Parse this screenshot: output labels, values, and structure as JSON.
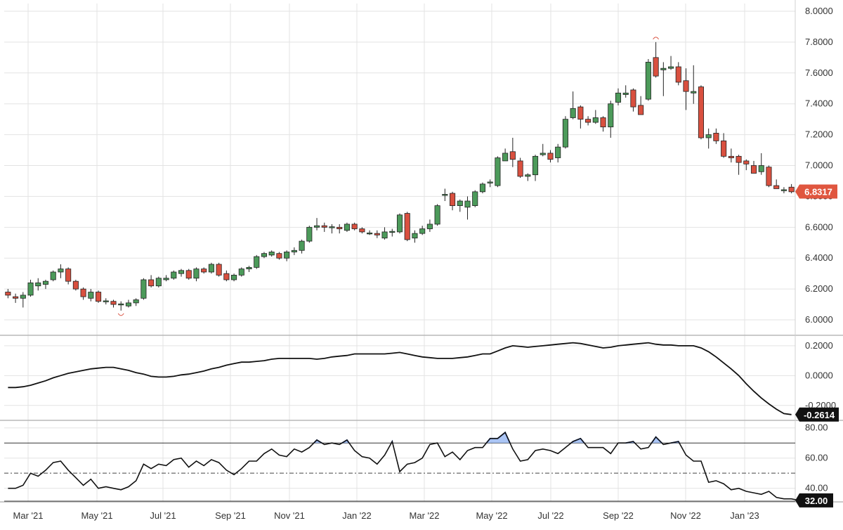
{
  "chart_data": {
    "type": "candlestick",
    "x_labels": [
      "Mar '21",
      "May '21",
      "Jul '21",
      "Sep '21",
      "Nov '21",
      "Jan '22",
      "Mar '22",
      "May '22",
      "Jul '22",
      "Sep '22",
      "Nov '22",
      "Jan '23"
    ],
    "price_axis": {
      "ylim": [
        5.9,
        8.05
      ],
      "ticks": [
        "8.0000",
        "7.8000",
        "7.6000",
        "7.4000",
        "7.2000",
        "7.0000",
        "6.8000",
        "6.6000",
        "6.4000",
        "6.2000",
        "6.0000"
      ],
      "tick_values": [
        8.0,
        7.8,
        7.6,
        7.4,
        7.2,
        7.0,
        6.8,
        6.6,
        6.4,
        6.2,
        6.0
      ]
    },
    "last_price": {
      "value": 6.8317,
      "label": "6.8317",
      "color": "#e0563f"
    },
    "colors": {
      "up": "#4c9a5a",
      "down": "#d9503f",
      "line": "#111111",
      "overbought_fill": "#8fb2f2",
      "overbought_line": "#2f63d8"
    },
    "candles": [
      [
        6.18,
        6.2,
        6.14,
        6.16
      ],
      [
        6.15,
        6.17,
        6.11,
        6.14
      ],
      [
        6.14,
        6.18,
        6.08,
        6.16
      ],
      [
        6.16,
        6.26,
        6.15,
        6.24
      ],
      [
        6.22,
        6.27,
        6.19,
        6.24
      ],
      [
        6.23,
        6.26,
        6.2,
        6.25
      ],
      [
        6.26,
        6.32,
        6.25,
        6.31
      ],
      [
        6.31,
        6.36,
        6.27,
        6.33
      ],
      [
        6.33,
        6.34,
        6.23,
        6.25
      ],
      [
        6.25,
        6.26,
        6.19,
        6.2
      ],
      [
        6.2,
        6.21,
        6.13,
        6.15
      ],
      [
        6.14,
        6.2,
        6.12,
        6.18
      ],
      [
        6.18,
        6.19,
        6.11,
        6.12
      ],
      [
        6.12,
        6.14,
        6.1,
        6.12
      ],
      [
        6.12,
        6.13,
        6.08,
        6.1
      ],
      [
        6.1,
        6.12,
        6.06,
        6.1
      ],
      [
        6.09,
        6.13,
        6.08,
        6.11
      ],
      [
        6.11,
        6.14,
        6.09,
        6.13
      ],
      [
        6.14,
        6.27,
        6.13,
        6.26
      ],
      [
        6.26,
        6.29,
        6.21,
        6.22
      ],
      [
        6.22,
        6.28,
        6.21,
        6.27
      ],
      [
        6.26,
        6.29,
        6.25,
        6.27
      ],
      [
        6.27,
        6.32,
        6.26,
        6.31
      ],
      [
        6.3,
        6.33,
        6.28,
        6.32
      ],
      [
        6.32,
        6.33,
        6.26,
        6.27
      ],
      [
        6.27,
        6.34,
        6.25,
        6.33
      ],
      [
        6.33,
        6.34,
        6.3,
        6.31
      ],
      [
        6.31,
        6.37,
        6.3,
        6.36
      ],
      [
        6.36,
        6.37,
        6.28,
        6.29
      ],
      [
        6.3,
        6.32,
        6.25,
        6.26
      ],
      [
        6.26,
        6.3,
        6.25,
        6.29
      ],
      [
        6.29,
        6.34,
        6.28,
        6.33
      ],
      [
        6.33,
        6.35,
        6.31,
        6.34
      ],
      [
        6.34,
        6.42,
        6.33,
        6.41
      ],
      [
        6.41,
        6.44,
        6.4,
        6.43
      ],
      [
        6.42,
        6.45,
        6.41,
        6.44
      ],
      [
        6.43,
        6.44,
        6.39,
        6.4
      ],
      [
        6.4,
        6.45,
        6.38,
        6.44
      ],
      [
        6.44,
        6.47,
        6.42,
        6.45
      ],
      [
        6.45,
        6.52,
        6.43,
        6.51
      ],
      [
        6.51,
        6.61,
        6.5,
        6.6
      ],
      [
        6.6,
        6.66,
        6.58,
        6.61
      ],
      [
        6.61,
        6.63,
        6.57,
        6.6
      ],
      [
        6.6,
        6.62,
        6.56,
        6.6
      ],
      [
        6.6,
        6.62,
        6.56,
        6.59
      ],
      [
        6.58,
        6.63,
        6.57,
        6.62
      ],
      [
        6.62,
        6.63,
        6.58,
        6.59
      ],
      [
        6.59,
        6.6,
        6.56,
        6.57
      ],
      [
        6.56,
        6.58,
        6.55,
        6.56
      ],
      [
        6.56,
        6.58,
        6.53,
        6.55
      ],
      [
        6.53,
        6.6,
        6.52,
        6.57
      ],
      [
        6.57,
        6.59,
        6.54,
        6.57
      ],
      [
        6.57,
        6.69,
        6.56,
        6.68
      ],
      [
        6.69,
        6.7,
        6.51,
        6.52
      ],
      [
        6.53,
        6.58,
        6.5,
        6.56
      ],
      [
        6.56,
        6.61,
        6.55,
        6.59
      ],
      [
        6.59,
        6.65,
        6.57,
        6.62
      ],
      [
        6.62,
        6.75,
        6.61,
        6.74
      ],
      [
        6.81,
        6.85,
        6.77,
        6.81
      ],
      [
        6.82,
        6.83,
        6.71,
        6.74
      ],
      [
        6.74,
        6.78,
        6.7,
        6.77
      ],
      [
        6.73,
        6.8,
        6.65,
        6.77
      ],
      [
        6.74,
        6.84,
        6.73,
        6.83
      ],
      [
        6.83,
        6.89,
        6.82,
        6.88
      ],
      [
        6.89,
        6.91,
        6.86,
        6.89
      ],
      [
        6.87,
        7.06,
        6.86,
        7.05
      ],
      [
        7.03,
        7.11,
        7.03,
        7.08
      ],
      [
        7.09,
        7.18,
        6.99,
        7.04
      ],
      [
        7.03,
        7.05,
        6.92,
        6.93
      ],
      [
        6.93,
        6.95,
        6.9,
        6.94
      ],
      [
        6.94,
        7.07,
        6.9,
        7.06
      ],
      [
        7.07,
        7.14,
        7.06,
        7.08
      ],
      [
        7.08,
        7.1,
        7.02,
        7.04
      ],
      [
        7.05,
        7.14,
        7.02,
        7.12
      ],
      [
        7.12,
        7.32,
        7.11,
        7.3
      ],
      [
        7.31,
        7.48,
        7.3,
        7.37
      ],
      [
        7.38,
        7.39,
        7.24,
        7.3
      ],
      [
        7.3,
        7.32,
        7.26,
        7.28
      ],
      [
        7.28,
        7.36,
        7.27,
        7.31
      ],
      [
        7.31,
        7.32,
        7.22,
        7.25
      ],
      [
        7.25,
        7.42,
        7.18,
        7.4
      ],
      [
        7.41,
        7.5,
        7.39,
        7.47
      ],
      [
        7.46,
        7.52,
        7.44,
        7.47
      ],
      [
        7.49,
        7.5,
        7.35,
        7.38
      ],
      [
        7.39,
        7.45,
        7.33,
        7.33
      ],
      [
        7.43,
        7.69,
        7.42,
        7.67
      ],
      [
        7.7,
        7.8,
        7.57,
        7.58
      ],
      [
        7.62,
        7.67,
        7.45,
        7.63
      ],
      [
        7.63,
        7.71,
        7.62,
        7.64
      ],
      [
        7.64,
        7.67,
        7.52,
        7.54
      ],
      [
        7.55,
        7.63,
        7.36,
        7.48
      ],
      [
        7.47,
        7.65,
        7.4,
        7.48
      ],
      [
        7.51,
        7.52,
        7.17,
        7.18
      ],
      [
        7.18,
        7.24,
        7.11,
        7.2
      ],
      [
        7.21,
        7.24,
        7.14,
        7.16
      ],
      [
        7.16,
        7.21,
        7.05,
        7.06
      ],
      [
        7.06,
        7.11,
        7.02,
        7.05
      ],
      [
        7.06,
        7.07,
        6.94,
        7.02
      ],
      [
        7.03,
        7.04,
        6.97,
        7.01
      ],
      [
        7.0,
        7.03,
        6.95,
        6.95
      ],
      [
        6.96,
        7.08,
        6.94,
        7.0
      ],
      [
        6.99,
        7.0,
        6.86,
        6.87
      ],
      [
        6.87,
        6.91,
        6.85,
        6.85
      ],
      [
        6.84,
        6.86,
        6.82,
        6.84
      ],
      [
        6.86,
        6.88,
        6.82,
        6.83
      ]
    ],
    "indicator1": {
      "ylim": [
        -0.3,
        0.27
      ],
      "ticks": [
        "0.2000",
        "0.0000",
        "-0.2000"
      ],
      "tick_values": [
        0.2,
        0.0,
        -0.2
      ],
      "last": {
        "value": -0.2614,
        "label": "-0.2614"
      },
      "values": [
        -0.08,
        -0.08,
        -0.075,
        -0.065,
        -0.05,
        -0.035,
        -0.015,
        0.0,
        0.015,
        0.025,
        0.035,
        0.045,
        0.05,
        0.055,
        0.055,
        0.045,
        0.035,
        0.02,
        0.01,
        -0.005,
        -0.01,
        -0.01,
        -0.005,
        0.005,
        0.01,
        0.02,
        0.03,
        0.045,
        0.055,
        0.07,
        0.08,
        0.09,
        0.09,
        0.095,
        0.1,
        0.11,
        0.115,
        0.115,
        0.115,
        0.115,
        0.115,
        0.11,
        0.115,
        0.125,
        0.13,
        0.135,
        0.145,
        0.145,
        0.145,
        0.145,
        0.145,
        0.15,
        0.155,
        0.145,
        0.135,
        0.125,
        0.12,
        0.115,
        0.115,
        0.115,
        0.12,
        0.125,
        0.135,
        0.145,
        0.145,
        0.165,
        0.185,
        0.2,
        0.195,
        0.19,
        0.195,
        0.2,
        0.205,
        0.21,
        0.215,
        0.22,
        0.215,
        0.205,
        0.195,
        0.185,
        0.19,
        0.2,
        0.205,
        0.21,
        0.215,
        0.22,
        0.21,
        0.205,
        0.205,
        0.2,
        0.2,
        0.2,
        0.185,
        0.16,
        0.125,
        0.085,
        0.045,
        0.0,
        -0.055,
        -0.105,
        -0.15,
        -0.19,
        -0.225,
        -0.255,
        -0.2614
      ]
    },
    "indicator2": {
      "ylim": [
        31,
        85
      ],
      "ticks": [
        "80.00",
        "60.00",
        "40.00"
      ],
      "tick_values": [
        80,
        60,
        40
      ],
      "overbought": 70,
      "oversold": 30,
      "midline": 50,
      "last": {
        "value": 32.0,
        "label": "32.00"
      },
      "values": [
        40,
        40,
        42,
        50,
        48,
        52,
        57,
        58,
        52,
        47,
        42,
        46,
        40,
        41,
        40,
        39,
        41,
        45,
        56,
        53,
        56,
        55,
        59,
        60,
        54,
        58,
        55,
        59,
        57,
        52,
        49,
        53,
        58,
        58,
        63,
        66,
        62,
        61,
        66,
        64,
        67,
        72,
        69,
        70,
        69,
        72,
        65,
        61,
        60,
        56,
        62,
        71,
        51,
        56,
        57,
        60,
        69,
        70,
        61,
        64,
        59,
        65,
        67,
        67,
        73,
        73,
        77,
        66,
        58,
        59,
        65,
        66,
        65,
        63,
        67,
        71,
        73,
        67,
        67,
        67,
        63,
        70,
        70,
        71,
        66,
        67,
        74,
        69,
        70,
        71,
        62,
        58,
        58,
        44,
        45,
        43,
        39,
        40,
        38,
        37,
        36,
        38,
        34,
        33,
        33,
        32
      ]
    }
  }
}
